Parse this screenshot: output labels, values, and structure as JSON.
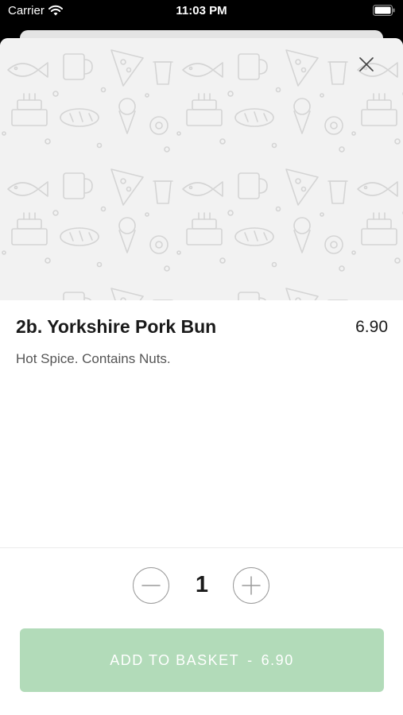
{
  "status_bar": {
    "carrier": "Carrier",
    "time": "11:03 PM",
    "wifi_icon": "wifi-icon",
    "battery_icon": "battery-icon"
  },
  "hero": {
    "pattern": "food-doodle-pattern",
    "close_icon": "close-icon"
  },
  "product": {
    "name": "2b. Yorkshire Pork Bun",
    "price": "6.90",
    "description": "Hot Spice. Contains Nuts."
  },
  "quantity": {
    "value": "1",
    "minus_icon": "minus-icon",
    "plus_icon": "plus-icon"
  },
  "add_to_basket": {
    "label": "ADD TO BASKET",
    "separator": "-",
    "price": "6.90"
  },
  "colors": {
    "accent": "#b2dbb9",
    "hero_background": "#f2f2f2",
    "doodle_stroke": "#d4d4d4"
  }
}
